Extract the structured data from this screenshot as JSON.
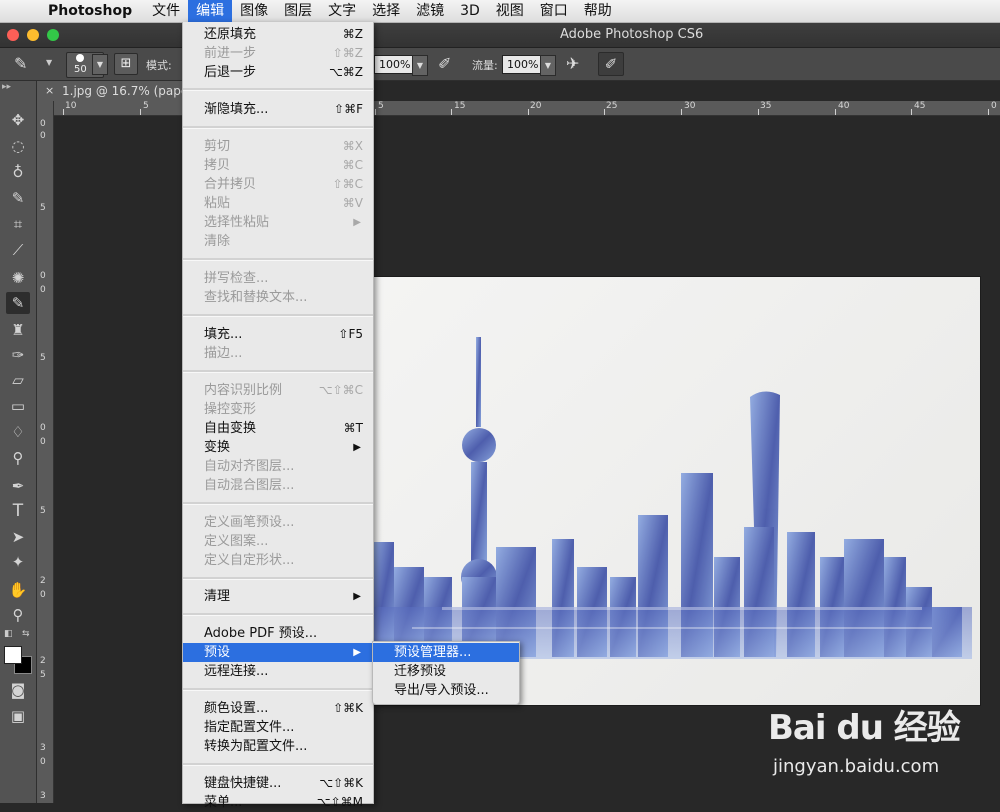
{
  "menubar": {
    "apple_icon": "apple-icon",
    "app_name": "Photoshop",
    "items": [
      "文件",
      "编辑",
      "图像",
      "图层",
      "文字",
      "选择",
      "滤镜",
      "3D",
      "视图",
      "窗口",
      "帮助"
    ],
    "active": "编辑"
  },
  "window": {
    "title": "Adobe Photoshop CS6"
  },
  "options": {
    "brush_size": "50",
    "mode_label": "模式:",
    "opacity_value": "100%",
    "flow_label": "流量:",
    "flow_value": "100%"
  },
  "document": {
    "tab_title": "1.jpg @ 16.7% (paper",
    "close_glyph": "×",
    "ruler_top": [
      "10",
      "5",
      "0",
      "5",
      "10",
      "15",
      "20",
      "25",
      "30",
      "35",
      "40",
      "45"
    ],
    "ruler_left": [
      "0",
      "5",
      "0",
      "5",
      "0",
      "5",
      "2",
      "0",
      "2",
      "5",
      "3",
      "0",
      "3"
    ]
  },
  "edit_menu": {
    "items": [
      {
        "label": "还原填充",
        "shortcut": "⌘Z",
        "enabled": true
      },
      {
        "label": "前进一步",
        "shortcut": "⇧⌘Z",
        "enabled": false
      },
      {
        "label": "后退一步",
        "shortcut": "⌥⌘Z",
        "enabled": true
      },
      {
        "label": "渐隐填充...",
        "shortcut": "⇧⌘F",
        "enabled": true
      },
      {
        "label": "剪切",
        "shortcut": "⌘X",
        "enabled": false
      },
      {
        "label": "拷贝",
        "shortcut": "⌘C",
        "enabled": false
      },
      {
        "label": "合并拷贝",
        "shortcut": "⇧⌘C",
        "enabled": false
      },
      {
        "label": "粘贴",
        "shortcut": "⌘V",
        "enabled": false
      },
      {
        "label": "选择性粘贴",
        "shortcut": "▶",
        "enabled": false
      },
      {
        "label": "清除",
        "shortcut": "",
        "enabled": false
      },
      {
        "label": "拼写检查...",
        "shortcut": "",
        "enabled": false
      },
      {
        "label": "查找和替换文本...",
        "shortcut": "",
        "enabled": false
      },
      {
        "label": "填充...",
        "shortcut": "⇧F5",
        "enabled": true
      },
      {
        "label": "描边...",
        "shortcut": "",
        "enabled": false
      },
      {
        "label": "内容识别比例",
        "shortcut": "⌥⇧⌘C",
        "enabled": false
      },
      {
        "label": "操控变形",
        "shortcut": "",
        "enabled": false
      },
      {
        "label": "自由变换",
        "shortcut": "⌘T",
        "enabled": true
      },
      {
        "label": "变换",
        "shortcut": "▶",
        "enabled": true
      },
      {
        "label": "自动对齐图层...",
        "shortcut": "",
        "enabled": false
      },
      {
        "label": "自动混合图层...",
        "shortcut": "",
        "enabled": false
      },
      {
        "label": "定义画笔预设...",
        "shortcut": "",
        "enabled": false
      },
      {
        "label": "定义图案...",
        "shortcut": "",
        "enabled": false
      },
      {
        "label": "定义自定形状...",
        "shortcut": "",
        "enabled": false
      },
      {
        "label": "清理",
        "shortcut": "▶",
        "enabled": true
      },
      {
        "label": "Adobe PDF 预设...",
        "shortcut": "",
        "enabled": true
      },
      {
        "label": "预设",
        "shortcut": "▶",
        "enabled": true
      },
      {
        "label": "远程连接...",
        "shortcut": "",
        "enabled": true
      },
      {
        "label": "颜色设置...",
        "shortcut": "⇧⌘K",
        "enabled": true
      },
      {
        "label": "指定配置文件...",
        "shortcut": "",
        "enabled": true
      },
      {
        "label": "转换为配置文件...",
        "shortcut": "",
        "enabled": true
      },
      {
        "label": "键盘快捷键...",
        "shortcut": "⌥⇧⌘K",
        "enabled": true
      },
      {
        "label": "菜单...",
        "shortcut": "⌥⇧⌘M",
        "enabled": true
      }
    ],
    "highlighted": "预设"
  },
  "preset_submenu": {
    "items": [
      "预设管理器...",
      "迁移预设",
      "导出/导入预设..."
    ],
    "highlighted": "预设管理器..."
  },
  "watermark": {
    "logo": "Bai du 经验",
    "url": "jingyan.baidu.com"
  },
  "colors": {
    "menu_highlight": "#2c6fe0",
    "panel_bg": "#535353",
    "workspace_bg": "#282828",
    "menu_bg": "#e9e9e9"
  }
}
